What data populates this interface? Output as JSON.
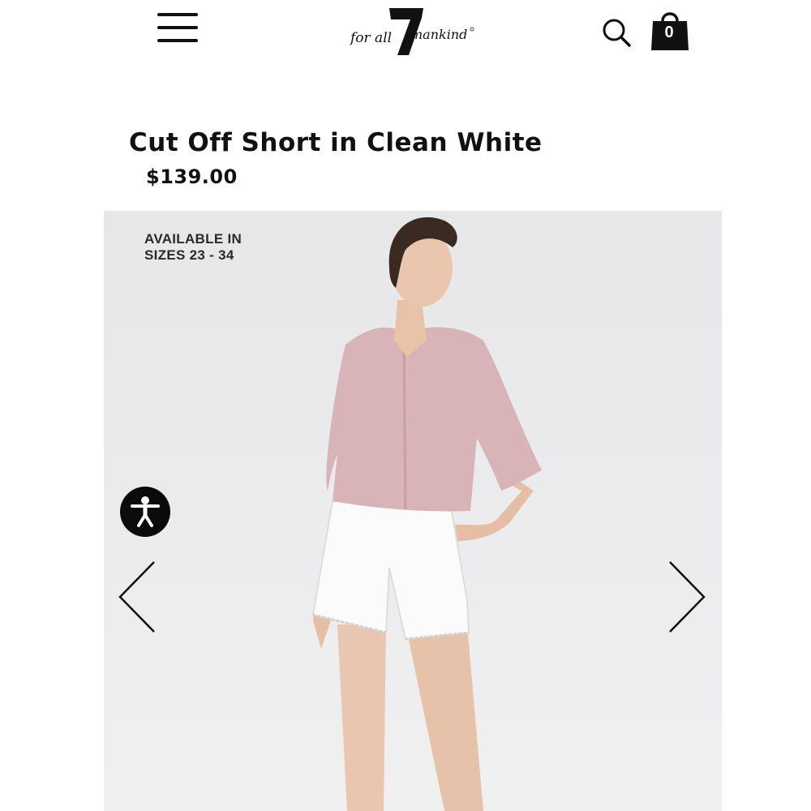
{
  "header": {
    "menu_icon": "hamburger-menu-icon",
    "logo_text": "for all mankind",
    "logo_mark": "7",
    "search_icon": "search-icon",
    "cart_icon": "shopping-bag-icon",
    "cart_count": "0"
  },
  "product": {
    "title": "Cut Off Short in Clean White",
    "price": "$139.00",
    "image_overlay_line1": "AVAILABLE IN",
    "image_overlay_line2": "SIZES 23 - 34",
    "image_icon": "model-photo",
    "background_color": "#ececee"
  },
  "carousel": {
    "prev_icon": "chevron-left-icon",
    "next_icon": "chevron-right-icon"
  },
  "accessibility": {
    "icon": "accessibility-icon",
    "button_color": "#0b0b0b"
  }
}
